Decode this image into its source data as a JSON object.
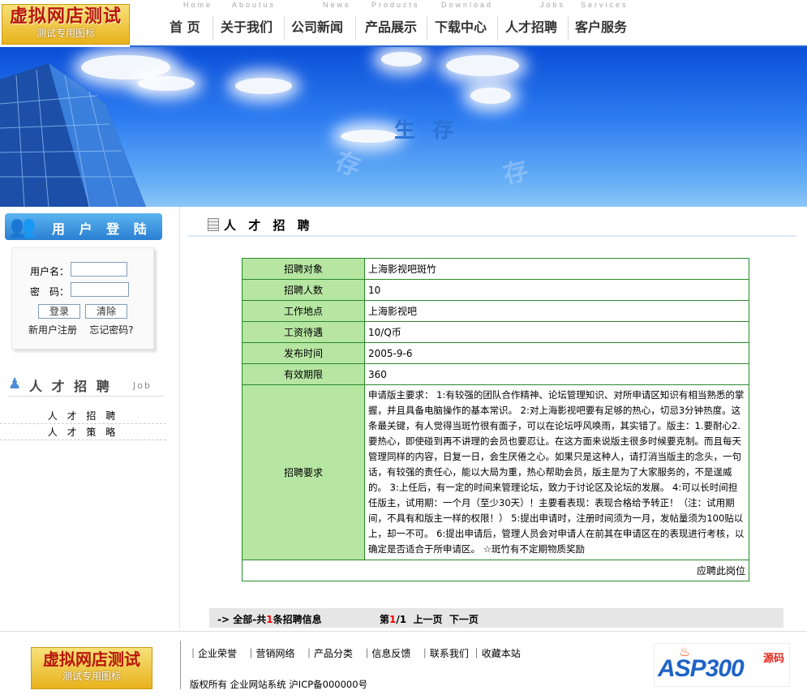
{
  "header": {
    "logo_line1": "虚拟网店测试",
    "logo_line2": "测试专用图标",
    "nav_en": [
      "Home",
      "Aboutus",
      "News",
      "Products",
      "Download",
      "Jobs",
      "Services"
    ],
    "nav": [
      "首 页",
      "关于我们",
      "公司新闻",
      "产品展示",
      "下载中心",
      "人才招聘",
      "客户服务"
    ]
  },
  "banner": {
    "text": "生 存"
  },
  "sidebar": {
    "login_title": "用 户 登 陆",
    "username_label": "用户名：",
    "password_label": "密　码：",
    "login_button": "登录",
    "clear_button": "清除",
    "register_link": "新用户注册",
    "forgot_link": "忘记密码?",
    "job_title": "人 才 招 聘",
    "job_title_en": "Job",
    "links": [
      "人 才 招 聘",
      "人 才 策 略"
    ]
  },
  "main": {
    "title": "人 才 招 聘",
    "rows": [
      {
        "key": "招聘对象",
        "value": "上海影视吧斑竹"
      },
      {
        "key": "招聘人数",
        "value": "10"
      },
      {
        "key": "工作地点",
        "value": "上海影视吧"
      },
      {
        "key": "工资待遇",
        "value": "10/Q币"
      },
      {
        "key": "发布时间",
        "value": "2005-9-6"
      },
      {
        "key": "有效期限",
        "value": "360"
      }
    ],
    "requirements_key": "招聘要求",
    "requirements": "申请版主要求： 1:有较强的团队合作精神、论坛管理知识、对所申请区知识有相当熟悉的掌握，并且具备电脑操作的基本常识。 2:对上海影视吧要有足够的热心，切忌3分钟热度。这条最关键，有人觉得当斑竹很有面子，可以在论坛呼风唤雨，其实错了。版主：1.要耐心2.要热心，即使碰到再不讲理的会员也要忍让。在这方面来说版主很多时候要克制。而且每天管理同样的内容，日复一日，会生厌倦之心。如果只是这种人，请打消当版主的念头，一句话，有较强的责任心，能以大局为重，热心帮助会员，版主是为了大家服务的，不是逞威的。 3:上任后，有一定的时间来管理论坛，致力于讨论区及论坛的发展。 4:可以长时间担任版主，试用期：一个月（至少30天）！主要看表现：表现合格给予转正！（注：试用期间，不具有和版主一样的权限！） 5:提出申请时，注册时间须为一月，发帖量须为100贴以上，却一不可。 6:提出申请后，管理人员会对申请人在前其在申请区在的表现进行考核，以确定是否适合于所申请区。 ☆斑竹有不定期物质奖励",
    "apply_link": "应聘此岗位"
  },
  "pager": {
    "prefix": "-> 全部-共",
    "count": "1",
    "suffix": "条招聘信息",
    "page_prefix": "第",
    "page_current": "1",
    "page_total": "/1",
    "prev": "上一页",
    "next": "下一页"
  },
  "footer": {
    "logo_line1": "虚拟网店测试",
    "logo_line2": "测试专用图标",
    "links": [
      "企业荣誉",
      "营销网络",
      "产品分类",
      "信息反馈",
      "联系我们",
      "收藏本站"
    ],
    "copyright": "版权所有  企业网站系统  沪ICP备000000号",
    "asp_logo_text": "ASP300",
    "asp_logo_cn": "源码"
  },
  "colors": {
    "table_border": "#2b8a2b",
    "table_key_bg": "#b6e6a2",
    "banner_blue": "#2d7cf0",
    "highlight_red": "#e00"
  }
}
